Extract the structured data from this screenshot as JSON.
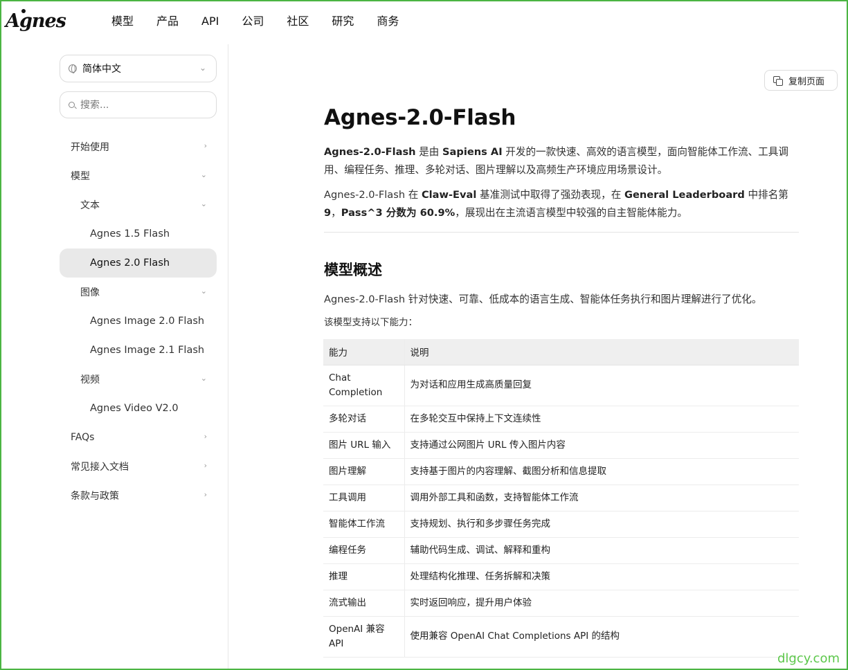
{
  "brand": {
    "logo_text": "Agnes"
  },
  "nav": {
    "items": [
      "模型",
      "产品",
      "API",
      "公司",
      "社区",
      "研究",
      "商务"
    ]
  },
  "sidebar": {
    "language": "简体中文",
    "search_placeholder": "搜索...",
    "menu": [
      {
        "label": "开始使用",
        "level": 0,
        "arrow": "›"
      },
      {
        "label": "模型",
        "level": 0,
        "arrow": "⌄"
      },
      {
        "label": "文本",
        "level": 1,
        "arrow": "⌄"
      },
      {
        "label": "Agnes 1.5 Flash",
        "level": 2
      },
      {
        "label": "Agnes 2.0 Flash",
        "level": 2,
        "active": true
      },
      {
        "label": "图像",
        "level": 1,
        "arrow": "⌄"
      },
      {
        "label": "Agnes Image 2.0 Flash",
        "level": 2
      },
      {
        "label": "Agnes Image 2.1 Flash",
        "level": 2
      },
      {
        "label": "视频",
        "level": 1,
        "arrow": "⌄"
      },
      {
        "label": "Agnes Video V2.0",
        "level": 2
      },
      {
        "label": "FAQs",
        "level": 0,
        "arrow": "›"
      },
      {
        "label": "常见接入文档",
        "level": 0,
        "arrow": "›"
      },
      {
        "label": "条款与政策",
        "level": 0,
        "arrow": "›"
      }
    ]
  },
  "toolbar": {
    "copy_label": "复制页面"
  },
  "article": {
    "title": "Agnes-2.0-Flash",
    "intro": {
      "model": "Agnes-2.0-Flash",
      "t1": " 是由 ",
      "org": "Sapiens AI",
      "t2": " 开发的一款快速、高效的语言模型，面向智能体工作流、工具调用、编程任务、推理、多轮对话、图片理解以及高频生产环境应用场景设计。"
    },
    "benchmark": {
      "t1": "Agnes-2.0-Flash 在 ",
      "bench1": "Claw-Eval",
      "t2": " 基准测试中取得了强劲表现，在 ",
      "bench2": "General Leaderboard",
      "t3": " 中排名第 ",
      "rank": "9",
      "t4": "，",
      "pass": "Pass^3 分数为 60.9%",
      "t5": "，展现出在主流语言模型中较强的自主智能体能力。"
    },
    "section_title": "模型概述",
    "section_desc": "Agnes-2.0-Flash 针对快速、可靠、低成本的语言生成、智能体任务执行和图片理解进行了优化。",
    "support_intro": "该模型支持以下能力：",
    "table": {
      "headers": [
        "能力",
        "说明"
      ],
      "rows": [
        [
          "Chat Completion",
          "为对话和应用生成高质量回复"
        ],
        [
          "多轮对话",
          "在多轮交互中保持上下文连续性"
        ],
        [
          "图片 URL 输入",
          "支持通过公网图片 URL 传入图片内容"
        ],
        [
          "图片理解",
          "支持基于图片的内容理解、截图分析和信息提取"
        ],
        [
          "工具调用",
          "调用外部工具和函数，支持智能体工作流"
        ],
        [
          "智能体工作流",
          "支持规划、执行和多步骤任务完成"
        ],
        [
          "编程任务",
          "辅助代码生成、调试、解释和重构"
        ],
        [
          "推理",
          "处理结构化推理、任务拆解和决策"
        ],
        [
          "流式输出",
          "实时返回响应，提升用户体验"
        ],
        [
          "OpenAI 兼容 API",
          "使用兼容 OpenAI Chat Completions API 的结构"
        ]
      ]
    }
  },
  "watermark": "dlgcy.com"
}
